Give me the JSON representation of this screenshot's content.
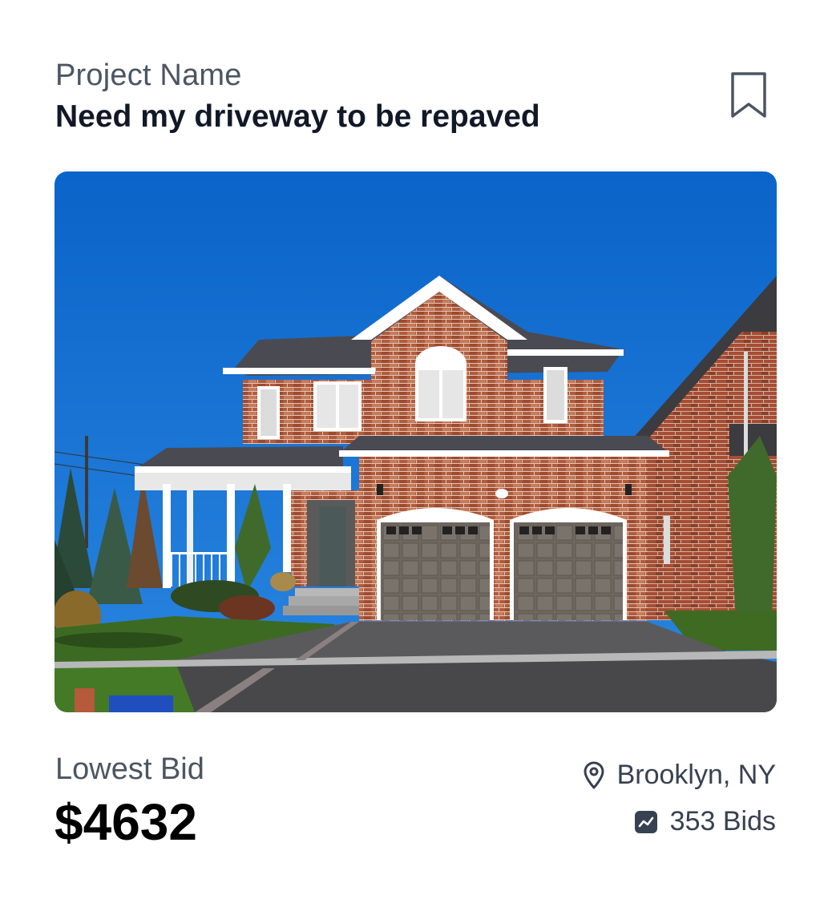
{
  "project": {
    "label": "Project Name",
    "title": "Need my driveway to be repaved"
  },
  "bookmark": {
    "icon": "bookmark-icon"
  },
  "photo": {
    "description_icon": "house-photo"
  },
  "bid": {
    "label": "Lowest Bid",
    "amount": "$4632"
  },
  "meta": {
    "location": "Brooklyn, NY",
    "location_icon": "map-pin-icon",
    "bids": "353 Bids",
    "bids_icon": "trend-chart-icon"
  },
  "colors": {
    "primary_text": "#111827",
    "secondary_text": "#4b5563",
    "icon": "#374151"
  }
}
